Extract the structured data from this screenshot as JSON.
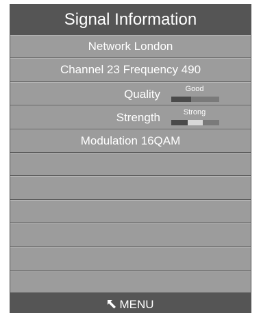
{
  "dialog": {
    "title": "Signal Information"
  },
  "info": {
    "network": "Network London",
    "channel": "Channel 23 Frequency 490",
    "modulation": "Modulation 16QAM"
  },
  "quality": {
    "label": "Quality",
    "rating": "Good",
    "level_fraction": 0.42
  },
  "strength": {
    "label": "Strength",
    "rating": "Strong",
    "level_fraction": 0.66
  },
  "footer": {
    "menu_label": "MENU",
    "menu_icon": "return-arrow-icon"
  },
  "colors": {
    "panel": "#555555",
    "row": "#9c9c9c",
    "meter_track": "#7a7a7a",
    "meter_fill": "#4a4a4a",
    "meter_highlight": "#d8d8d8"
  }
}
